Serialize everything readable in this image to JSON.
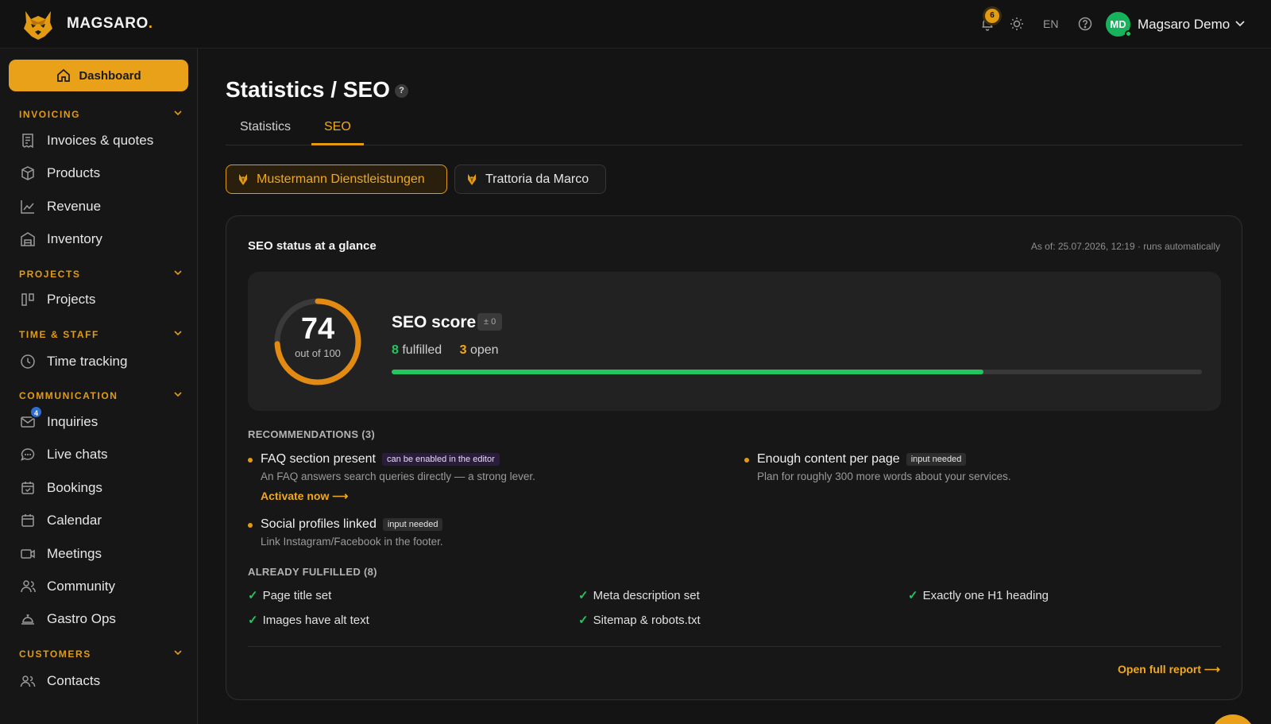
{
  "header": {
    "brand": "MAGSARO",
    "brand_dot": ".",
    "notifications_count": "6",
    "language": "EN",
    "user_initials": "MD",
    "user_name": "Magsaro Demo"
  },
  "sidebar": {
    "dashboard_label": "Dashboard",
    "sections": [
      {
        "label": "INVOICING",
        "items": [
          "Invoices & quotes",
          "Products",
          "Revenue",
          "Inventory"
        ]
      },
      {
        "label": "PROJECTS",
        "items": [
          "Projects"
        ]
      },
      {
        "label": "TIME & STAFF",
        "items": [
          "Time tracking"
        ]
      },
      {
        "label": "COMMUNICATION",
        "items": [
          "Inquiries",
          "Live chats",
          "Bookings",
          "Calendar",
          "Meetings",
          "Community",
          "Gastro Ops"
        ]
      },
      {
        "label": "CUSTOMERS",
        "items": [
          "Contacts"
        ]
      }
    ],
    "inquiries_badge": "4"
  },
  "page": {
    "title": "Statistics / SEO",
    "help": "?",
    "tabs": [
      "Statistics",
      "SEO"
    ],
    "active_tab": "SEO",
    "businesses": [
      "Mustermann Dienstleistungen",
      "Trattoria da Marco"
    ]
  },
  "seo": {
    "card_title": "SEO status at a glance",
    "as_of": "As of: 25.07.2026, 12:19 · runs automatically",
    "score": "74",
    "score_sub": "out of 100",
    "score_fraction": 0.74,
    "score_label": "SEO score",
    "delta": "± 0",
    "fulfilled_count": "8",
    "fulfilled_word": "fulfilled",
    "open_count": "3",
    "open_word": "open",
    "progress_fraction": 0.73,
    "recommendations_heading": "RECOMMENDATIONS (3)",
    "recommendations": [
      {
        "title": "FAQ section present",
        "tag": "can be enabled in the editor",
        "desc": "An FAQ answers search queries directly — a strong lever.",
        "action": "Activate now ⟶"
      },
      {
        "title": "Enough content per page",
        "tag": "input needed",
        "desc": "Plan for roughly 300 more words about your services."
      },
      {
        "title": "Social profiles linked",
        "tag": "input needed",
        "desc": "Link Instagram/Facebook in the footer."
      }
    ],
    "fulfilled_heading": "ALREADY FULFILLED (8)",
    "fulfilled": [
      "Page title set",
      "Meta description set",
      "Exactly one H1 heading",
      "Images have alt text",
      "Sitemap & robots.txt"
    ],
    "check_glyph": "✓",
    "full_report": "Open full report ⟶"
  },
  "colors": {
    "accent": "#e39b12",
    "success": "#22c55e",
    "background": "#141414",
    "card": "#171717",
    "badge_blue": "#2b6fd6"
  }
}
